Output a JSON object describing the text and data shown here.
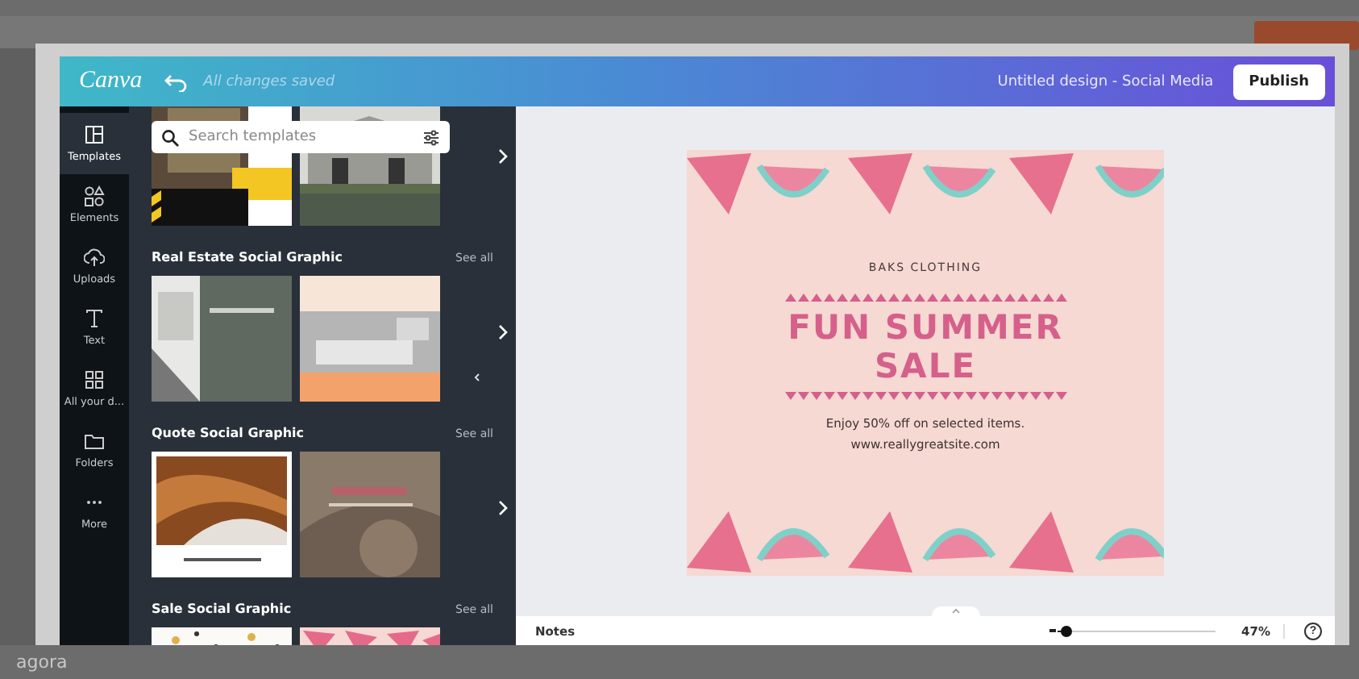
{
  "background": {
    "brand": "agora"
  },
  "header": {
    "logo": "Canva",
    "status": "All changes saved",
    "design_title": "Untitled design - Social Media",
    "publish": "Publish"
  },
  "rail": [
    {
      "label": "Templates",
      "kind": "templates",
      "selected": true
    },
    {
      "label": "Elements",
      "kind": "elements",
      "selected": false
    },
    {
      "label": "Uploads",
      "kind": "uploads",
      "selected": false
    },
    {
      "label": "Text",
      "kind": "text",
      "selected": false
    },
    {
      "label": "All your d...",
      "kind": "grid",
      "selected": false
    },
    {
      "label": "Folders",
      "kind": "folder",
      "selected": false
    },
    {
      "label": "More",
      "kind": "more",
      "selected": false
    }
  ],
  "search": {
    "placeholder": "Search templates"
  },
  "sections": [
    {
      "thumbnails": [
        {
          "kind": "picture"
        },
        {
          "kind": "picture"
        }
      ]
    },
    {
      "title": "Real Estate Social Graphic",
      "see_all": "See all",
      "thumbnails": [
        {
          "kind": "picture"
        },
        {
          "kind": "picture"
        }
      ]
    },
    {
      "title": "Quote Social Graphic",
      "see_all": "See all",
      "thumbnails": [
        {
          "kind": "picture"
        },
        {
          "kind": "picture"
        }
      ]
    },
    {
      "title": "Sale Social Graphic",
      "see_all": "See all",
      "thumbnails": [
        {
          "kind": "picture"
        },
        {
          "kind": "picture"
        }
      ]
    }
  ],
  "design": {
    "brand": "BAKS CLOTHING",
    "headline": "FUN SUMMER SALE",
    "offer": "Enjoy 50% off on selected items.",
    "website": "www.reallygreatsite.com"
  },
  "footer": {
    "notes": "Notes",
    "zoom": {
      "level": 0.05
    },
    "zoom_reading": "47%",
    "help": "?"
  }
}
